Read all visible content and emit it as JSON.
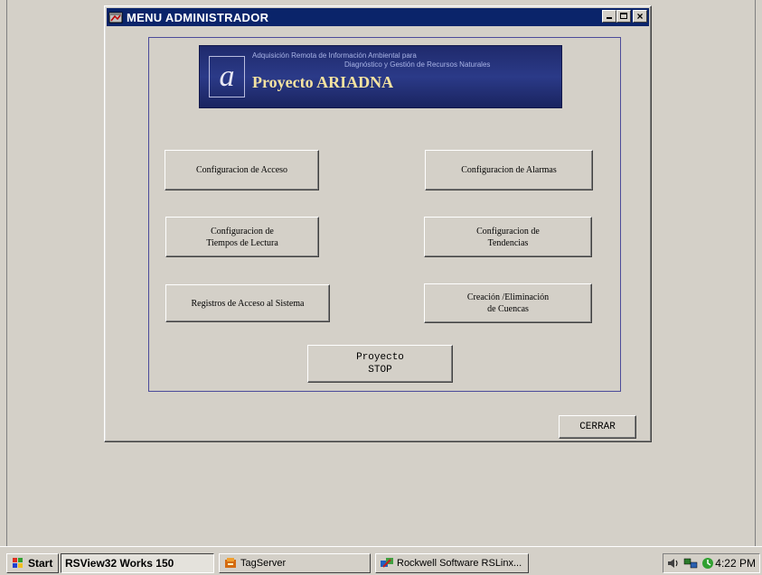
{
  "window": {
    "title": "MENU ADMINISTRADOR",
    "icon": "app-window-icon",
    "controls": {
      "minimize": "minimize-icon",
      "maximize": "maximize-icon",
      "close": "close-icon",
      "close_glyph": "×"
    }
  },
  "banner": {
    "logo_letter": "a",
    "line1": "Adquisición Remota de Información Ambiental para",
    "line2": "Diagnóstico y Gestión de Recursos Naturales",
    "title": "Proyecto ARIADNA"
  },
  "buttons": {
    "config_acceso": "Configuracion de Acceso",
    "config_alarmas": "Configuracion de Alarmas",
    "config_tiempos": "Configuracion de\nTiempos de Lectura",
    "config_tendencias": "Configuracion de\nTendencias",
    "registros": "Registros de Acceso al Sistema",
    "cuencas": "Creación /Eliminación\nde Cuencas",
    "stop": "Proyecto\nSTOP",
    "cerrar": "CERRAR"
  },
  "taskbar": {
    "start": "Start",
    "items": [
      {
        "label": "RSView32 Works 150",
        "icon": ""
      },
      {
        "label": "TagServer",
        "icon": "tagserver-icon"
      },
      {
        "label": "Rockwell Software RSLinx...",
        "icon": "rslinx-icon"
      }
    ],
    "tray_icons": [
      "speaker-icon",
      "network-icon",
      "scheduler-icon"
    ],
    "clock": "4:22 PM"
  },
  "colors": {
    "titlebar": "#0a246a",
    "face": "#d4d0c8",
    "panel_border": "#4b4b9a",
    "banner_bg": "#2b3a88",
    "banner_title": "#f4e2a0"
  }
}
